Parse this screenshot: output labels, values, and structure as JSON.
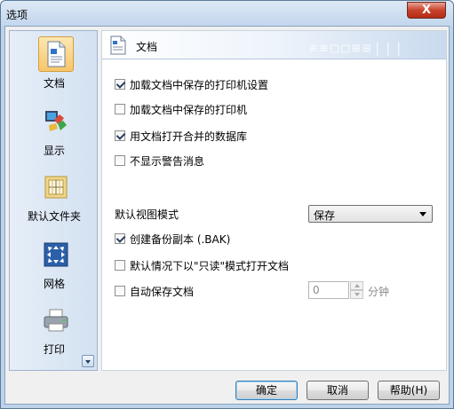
{
  "window": {
    "title": "选项",
    "close_label": "X"
  },
  "sidebar": {
    "items": [
      {
        "label": "文档",
        "icon": "document-icon",
        "selected": true
      },
      {
        "label": "显示",
        "icon": "display-icon",
        "selected": false
      },
      {
        "label": "默认文件夹",
        "icon": "folder-icon",
        "selected": false
      },
      {
        "label": "网格",
        "icon": "grid-icon",
        "selected": false
      },
      {
        "label": "打印",
        "icon": "printer-icon",
        "selected": false
      }
    ],
    "scroll_icon": "chevron-down-icon"
  },
  "content": {
    "header_title": "文档",
    "options": [
      {
        "label": "加载文档中保存的打印机设置",
        "checked": true
      },
      {
        "label": "加载文档中保存的打印机",
        "checked": false
      },
      {
        "label": "用文档打开合并的数据库",
        "checked": true
      },
      {
        "label": "不显示警告消息",
        "checked": false
      }
    ],
    "view_mode": {
      "label": "默认视图模式",
      "value": "保存"
    },
    "options2": [
      {
        "label": "创建备份副本 (.BAK)",
        "checked": true
      },
      {
        "label": "默认情况下以\"只读\"模式打开文档",
        "checked": false
      },
      {
        "label": "自动保存文档",
        "checked": false
      }
    ],
    "autosave": {
      "value": "0",
      "unit": "分钟"
    }
  },
  "footer": {
    "ok": "确定",
    "cancel": "取消",
    "help": "帮助(H)"
  },
  "colors": {
    "selected_bg": "#f8c56a",
    "titlebar": "#c3d6ec",
    "close": "#c7422c"
  }
}
